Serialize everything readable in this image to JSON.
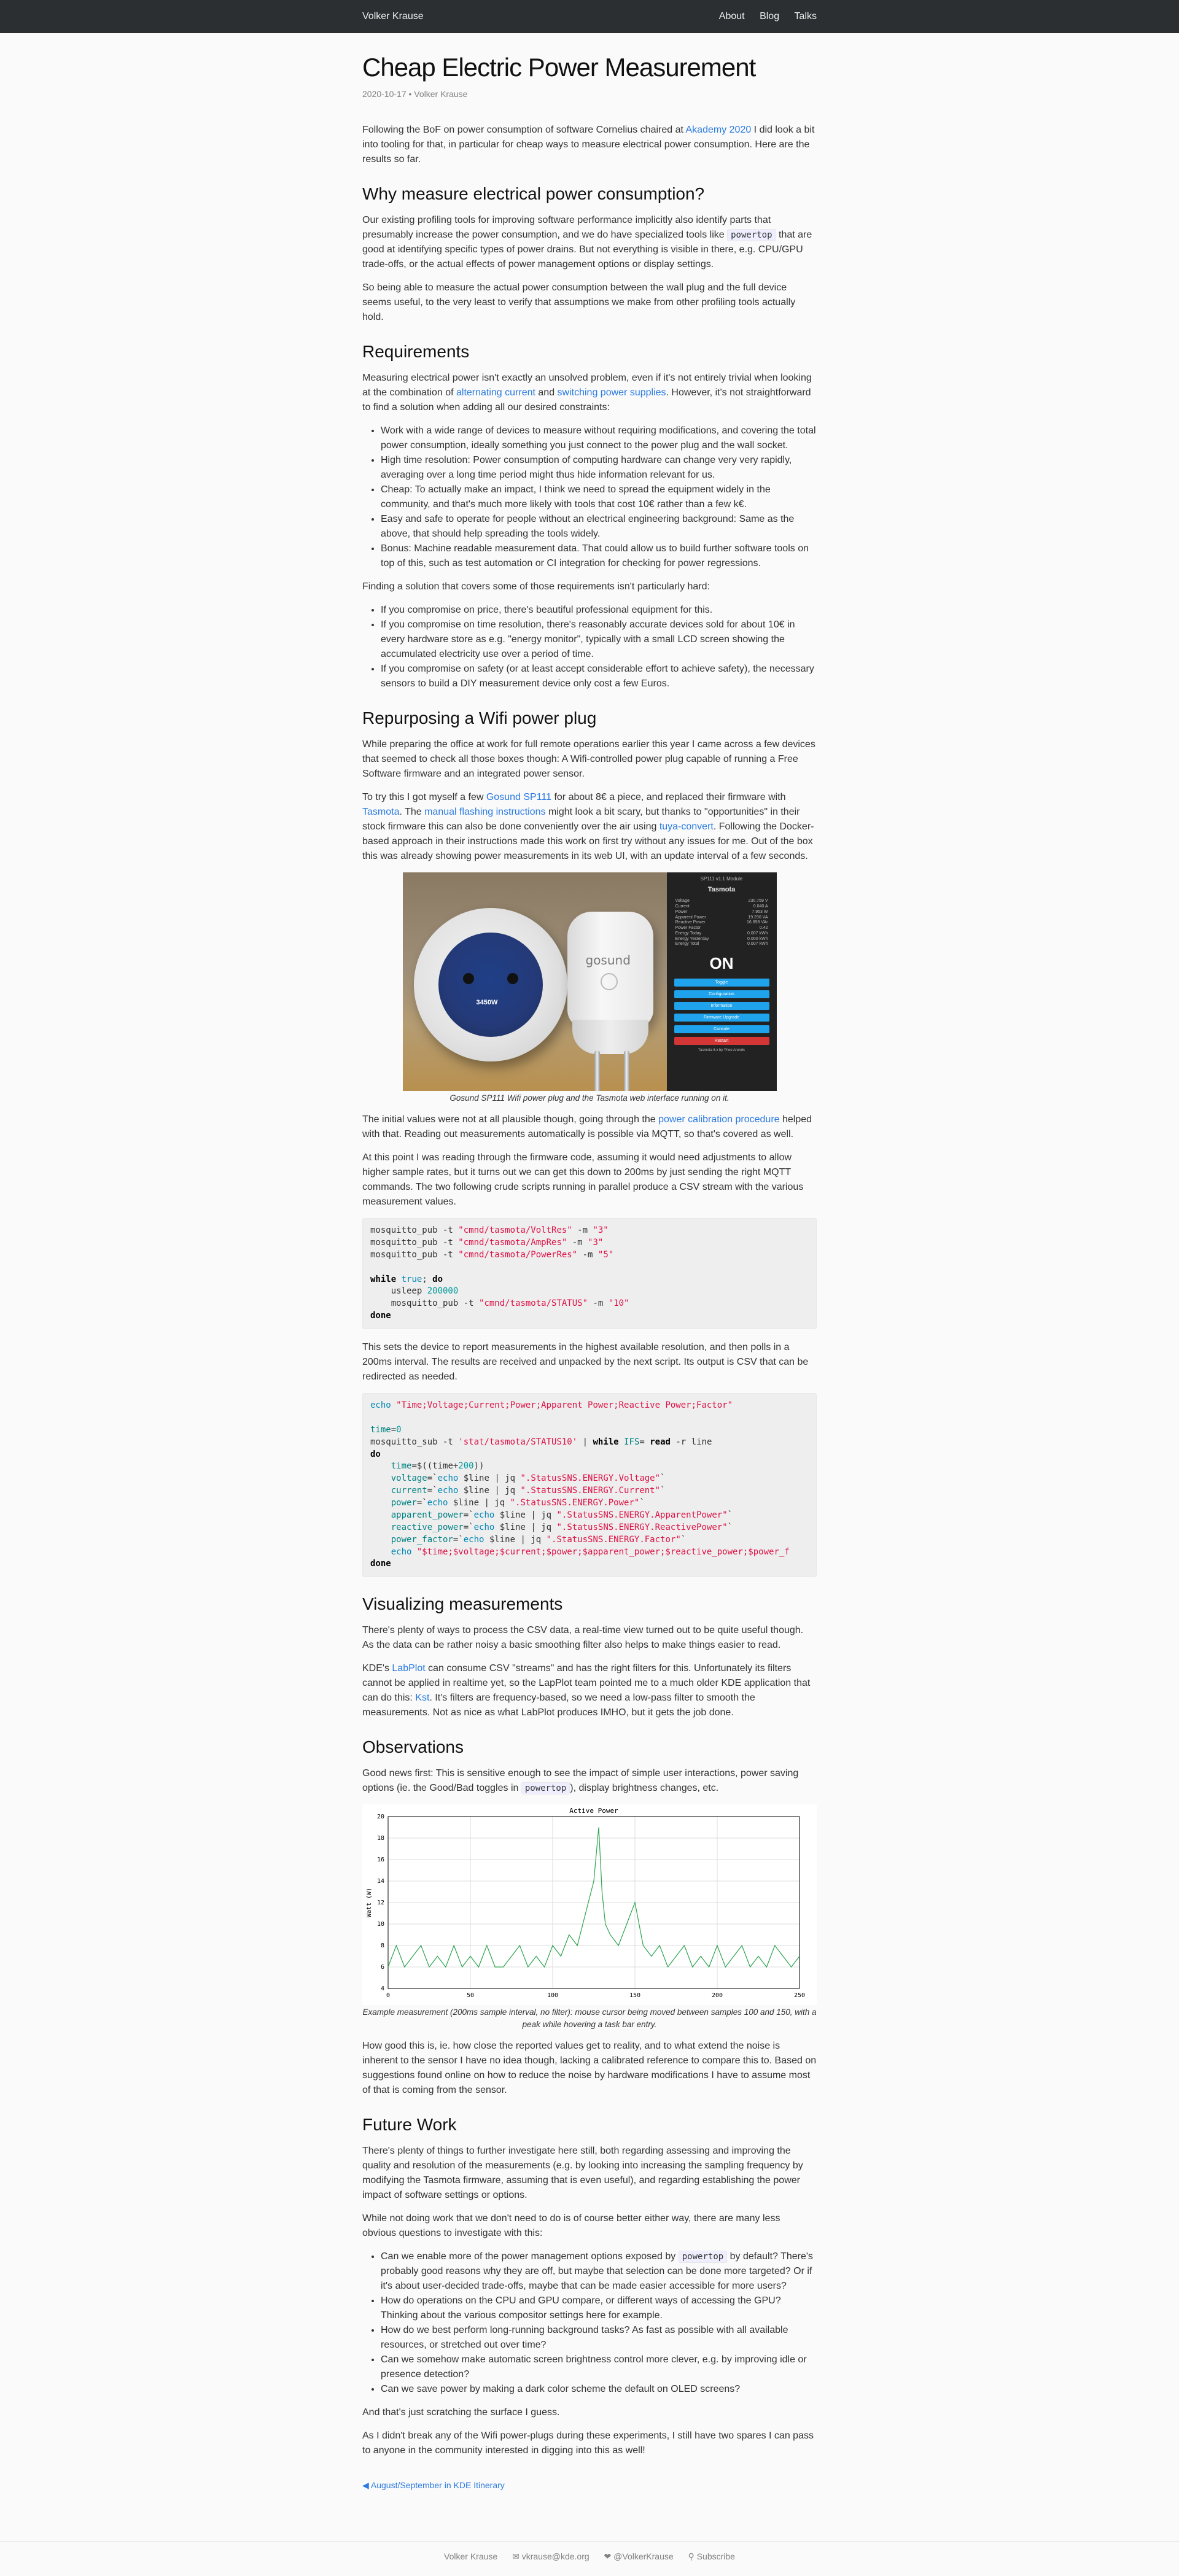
{
  "header": {
    "site_title": "Volker Krause",
    "nav": [
      "About",
      "Blog",
      "Talks"
    ]
  },
  "post": {
    "title": "Cheap Electric Power Measurement",
    "meta": "2020-10-17 • Volker Krause",
    "intro_pre": "Following the BoF on power consumption of software Cornelius chaired at ",
    "intro_link": "Akademy 2020",
    "intro_post": " I did look a bit into tooling for that, in particular for cheap ways to measure electrical power consumption. Here are the results so far.",
    "h_why": "Why measure electrical power consumption?",
    "why_p1_pre": "Our existing profiling tools for improving software performance implicitly also identify parts that presumably increase the power consumption, and we do have specialized tools like ",
    "why_p1_code": "powertop",
    "why_p1_post": " that are good at identifying specific types of power drains. But not everything is visible in there, e.g. CPU/GPU trade-offs, or the actual effects of power management options or display settings.",
    "why_p2": "So being able to measure the actual power consumption between the wall plug and the full device seems useful, to the very least to verify that assumptions we make from other profiling tools actually hold.",
    "h_req": "Requirements",
    "req_p1_a": "Measuring electrical power isn't exactly an unsolved problem, even if it's not entirely trivial when looking at the combination of ",
    "req_p1_link1": "alternating current",
    "req_p1_b": " and ",
    "req_p1_link2": "switching power supplies",
    "req_p1_c": ". However, it's not straightforward to find a solution when adding all our desired constraints:",
    "req_list": [
      "Work with a wide range of devices to measure without requiring modifications, and covering the total power consumption, ideally something you just connect to the power plug and the wall socket.",
      "High time resolution: Power consumption of computing hardware can change very very rapidly, averaging over a long time period might thus hide information relevant for us.",
      "Cheap: To actually make an impact, I think we need to spread the equipment widely in the community, and that's much more likely with tools that cost 10€ rather than a few k€.",
      "Easy and safe to operate for people without an electrical engineering background: Same as the above, that should help spreading the tools widely.",
      "Bonus: Machine readable measurement data. That could allow us to build further software tools on top of this, such as test automation or CI integration for checking for power regressions."
    ],
    "req_p2": "Finding a solution that covers some of those requirements isn't particularly hard:",
    "req_list2": [
      "If you compromise on price, there's beautiful professional equipment for this.",
      "If you compromise on time resolution, there's reasonably accurate devices sold for about 10€ in every hardware store as e.g. \"energy monitor\", typically with a small LCD screen showing the accumulated electricity use over a period of time.",
      "If you compromise on safety (or at least accept considerable effort to achieve safety), the necessary sensors to build a DIY measurement device only cost a few Euros."
    ],
    "h_wifi": "Repurposing a Wifi power plug",
    "wifi_p1": "While preparing the office at work for full remote operations earlier this year I came across a few devices that seemed to check all those boxes though: A Wifi-controlled power plug capable of running a Free Software firmware and an integrated power sensor.",
    "wifi_p2_a": "To try this I got myself a few ",
    "wifi_p2_link1": "Gosund SP111",
    "wifi_p2_b": " for about 8€ a piece, and replaced their firmware with ",
    "wifi_p2_link2": "Tasmota",
    "wifi_p2_c": ". The ",
    "wifi_p2_link3": "manual flashing instructions",
    "wifi_p2_d": " might look a bit scary, but thanks to \"opportunities\" in their stock firmware this can also be done conveniently over the air using ",
    "wifi_p2_link4": "tuya-convert",
    "wifi_p2_e": ". Following the Docker-based approach in their instructions made this work on first try without any issues for me. Out of the box this was already showing power measurements in its web UI, with an update interval of a few seconds.",
    "photo_caption": "Gosund SP111 Wifi power plug and the Tasmota web interface running on it.",
    "wifi_p3_a": "The initial values were not at all plausible though, going through the ",
    "wifi_p3_link": "power calibration procedure",
    "wifi_p3_b": " helped with that. Reading out measurements automatically is possible via MQTT, so that's covered as well.",
    "wifi_p4": "At this point I was reading through the firmware code, assuming it would need adjustments to allow higher sample rates, but it turns out we can get this down to 200ms by just sending the right MQTT commands. The two following crude scripts running in parallel produce a CSV stream with the various measurement values.",
    "wifi_p5": "This sets the device to report measurements in the highest available resolution, and then polls in a 200ms interval. The results are received and unpacked by the next script. Its output is CSV that can be redirected as needed.",
    "h_vis": "Visualizing measurements",
    "vis_p1": "There's plenty of ways to process the CSV data, a real-time view turned out to be quite useful though. As the data can be rather noisy a basic smoothing filter also helps to make things easier to read.",
    "vis_p2_a": "KDE's ",
    "vis_p2_link1": "LabPlot",
    "vis_p2_b": " can consume CSV \"streams\" and has the right filters for this. Unfortunately its filters cannot be applied in realtime yet, so the LapPlot team pointed me to a much older KDE application that can do this: ",
    "vis_p2_link2": "Kst",
    "vis_p2_c": ". It's filters are frequency-based, so we need a low-pass filter to smooth the measurements. Not as nice as what LabPlot produces IMHO, but it gets the job done.",
    "h_obs": "Observations",
    "obs_p1_a": "Good news first: This is sensitive enough to see the impact of simple user interactions, power saving options (ie. the Good/Bad toggles in ",
    "obs_p1_code": "powertop",
    "obs_p1_b": "), display brightness changes, etc.",
    "chart_caption": "Example measurement (200ms sample interval, no filter): mouse cursor being moved between samples 100 and 150, with a peak while hovering a task bar entry.",
    "obs_p2": "How good this is, ie. how close the reported values get to reality, and to what extend the noise is inherent to the sensor I have no idea though, lacking a calibrated reference to compare this to. Based on suggestions found online on how to reduce the noise by hardware modifications I have to assume most of that is coming from the sensor.",
    "h_future": "Future Work",
    "fut_p1": "There's plenty of things to further investigate here still, both regarding assessing and improving the quality and resolution of the measurements (e.g. by looking into increasing the sampling frequency by modifying the Tasmota firmware, assuming that is even useful), and regarding establishing the power impact of software settings or options.",
    "fut_p2": "While not doing work that we don't need to do is of course better either way, there are many less obvious questions to investigate with this:",
    "fut_li1_a": "Can we enable more of the power management options exposed by ",
    "fut_li1_code": "powertop",
    "fut_li1_b": " by default? There's probably good reasons why they are off, but maybe that selection can be done more targeted? Or if it's about user-decided trade-offs, maybe that can be made easier accessible for more users?",
    "fut_list": [
      "How do operations on the CPU and GPU compare, or different ways of accessing the GPU? Thinking about the various compositor settings here for example.",
      "How do we best perform long-running background tasks? As fast as possible with all available resources, or stretched out over time?",
      "Can we somehow make automatic screen brightness control more clever, e.g. by improving idle or presence detection?",
      "Can we save power by making a dark color scheme the default on OLED screens?"
    ],
    "fut_p3": "And that's just scratching the surface I guess.",
    "fut_p4": "As I didn't break any of the Wifi power-plugs during these experiments, I still have two spares I can pass to anyone in the community interested in digging into this as well!",
    "prev_link": "◀ August/September in KDE Itinerary"
  },
  "code1": [
    "mosquitto_pub -t \"cmnd/tasmota/VoltRes\" -m \"3\"",
    "mosquitto_pub -t \"cmnd/tasmota/AmpRes\" -m \"3\"",
    "mosquitto_pub -t \"cmnd/tasmota/PowerRes\" -m \"5\"",
    "",
    "while true; do",
    "    usleep 200000",
    "    mosquitto_pub -t \"cmnd/tasmota/STATUS\" -m \"10\"",
    "done"
  ],
  "code2": [
    "echo \"Time;Voltage;Current;Power;Apparent Power;Reactive Power;Factor\"",
    "",
    "time=0",
    "mosquitto_sub -t 'stat/tasmota/STATUS10' | while IFS= read -r line",
    "do",
    "    time=$((time+200))",
    "    voltage=`echo $line | jq \".StatusSNS.ENERGY.Voltage\"`",
    "    current=`echo $line | jq \".StatusSNS.ENERGY.Current\"`",
    "    power=`echo $line | jq \".StatusSNS.ENERGY.Power\"`",
    "    apparent_power=`echo $line | jq \".StatusSNS.ENERGY.ApparentPower\"`",
    "    reactive_power=`echo $line | jq \".StatusSNS.ENERGY.ReactivePower\"`",
    "    power_factor=`echo $line | jq \".StatusSNS.ENERGY.Factor\"`",
    "    echo \"$time;$voltage;$current;$power;$apparent_power;$reactive_power;$power_f",
    "done"
  ],
  "photo": {
    "plug_logo": "gosund",
    "plug_rating": "3450W",
    "ui_header": "SP111 v1.1 Module",
    "ui_name": "Tasmota",
    "ui_rows": [
      [
        "Voltage",
        "230.759 V"
      ],
      [
        "Current",
        "0.040 A"
      ],
      [
        "Power",
        "7.953 W"
      ],
      [
        "Apparent Power",
        "19.290 VA"
      ],
      [
        "Reactive Power",
        "16.898 VAr"
      ],
      [
        "Power Factor",
        "0.42"
      ],
      [
        "Energy Today",
        "0.007 kWh"
      ],
      [
        "Energy Yesterday",
        "0.000 kWh"
      ],
      [
        "Energy Total",
        "0.007 kWh"
      ]
    ],
    "ui_state": "ON",
    "ui_buttons": [
      "Toggle",
      "Configuration",
      "Information",
      "Firmware Upgrade",
      "Console",
      "Restart"
    ],
    "ui_footer": "Tasmota 8.x by Theo Arends"
  },
  "chart_data": {
    "type": "line",
    "title": "Active Power",
    "xlabel": "",
    "ylabel": "Watt (W)",
    "xlim": [
      0,
      250
    ],
    "ylim": [
      4,
      20
    ],
    "xticks": [
      0,
      50,
      100,
      150,
      200,
      250
    ],
    "yticks": [
      4,
      6,
      8,
      10,
      12,
      14,
      16,
      18,
      20
    ],
    "grid": true,
    "color": "#2ca44f",
    "series": [
      {
        "x": [
          0,
          5,
          10,
          15,
          20,
          25,
          30,
          35,
          40,
          45,
          50,
          55,
          60,
          65,
          70,
          75,
          80,
          85,
          90,
          95,
          100,
          105,
          110,
          115,
          120,
          125,
          128,
          130,
          132,
          135,
          140,
          145,
          150,
          155,
          160,
          165,
          170,
          175,
          180,
          185,
          190,
          195,
          200,
          205,
          210,
          215,
          220,
          225,
          230,
          235,
          240,
          245,
          250
        ],
        "values": [
          6,
          8,
          6,
          7,
          8,
          6,
          7,
          6,
          8,
          6,
          7,
          6,
          8,
          6,
          6,
          7,
          8,
          6,
          7,
          6,
          8,
          7,
          9,
          8,
          11,
          14,
          19,
          13,
          10,
          9,
          8,
          10,
          12,
          8,
          7,
          8,
          6,
          7,
          8,
          6,
          7,
          6,
          8,
          6,
          7,
          8,
          6,
          7,
          6,
          8,
          7,
          6,
          7
        ]
      }
    ]
  },
  "footer": {
    "name": "Volker Krause",
    "email": "✉ vkrause@kde.org",
    "twitter": "❤ @VolkerKrause",
    "subscribe": "⚲ Subscribe"
  }
}
